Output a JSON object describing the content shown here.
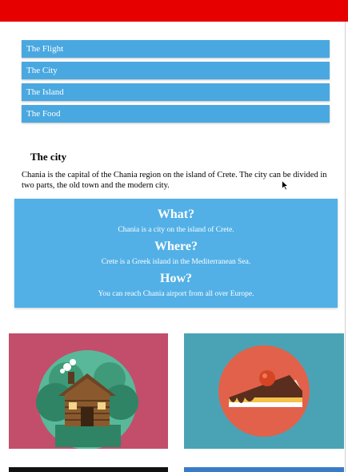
{
  "nav": {
    "items": [
      {
        "label": "The Flight"
      },
      {
        "label": "The City"
      },
      {
        "label": "The Island"
      },
      {
        "label": "The Food"
      }
    ]
  },
  "content": {
    "heading": "The city",
    "paragraph": "Chania is the capital of the Chania region on the island of Crete. The city can be divided in two parts, the old town and the modern city."
  },
  "info_box": {
    "what_title": "What?",
    "what_text": "Chania is a city on the island of Crete.",
    "where_title": "Where?",
    "where_text": "Crete is a Greek island in the Mediterranean Sea.",
    "how_title": "How?",
    "how_text": "You can reach Chania airport from all over Europe."
  },
  "cards": [
    {
      "icon": "log-cabin-icon",
      "bg": "#c24e6b"
    },
    {
      "icon": "cake-slice-icon",
      "bg": "#4aa3b5"
    },
    {
      "bg": "#111111"
    },
    {
      "bg": "#3a7bc8"
    }
  ],
  "colors": {
    "top_bar": "#e60000",
    "nav_item": "#4aa8e0",
    "info_box": "#52b0e6"
  }
}
